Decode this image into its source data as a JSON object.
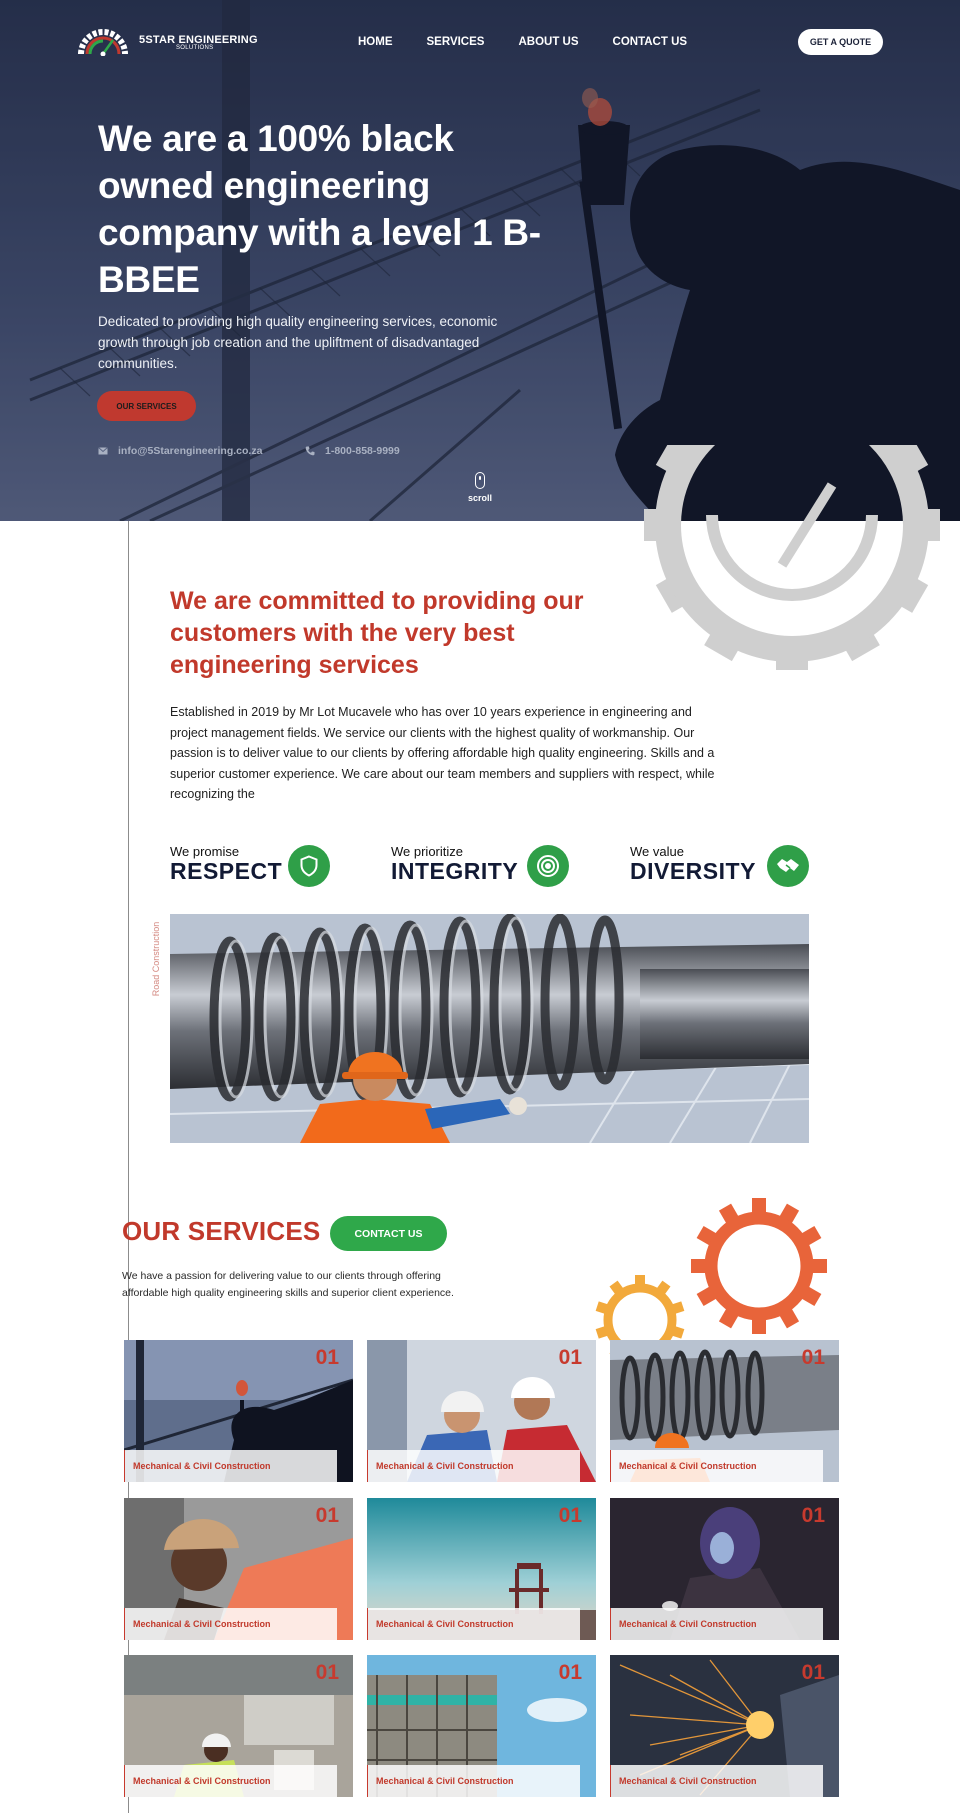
{
  "nav": {
    "logo_title": "5STAR ENGINEERING",
    "logo_subtitle": "SOLUTIONS",
    "links": [
      "HOME",
      "SERVICES",
      "ABOUT US",
      "CONTACT US"
    ],
    "quote_button": "GET A QUOTE"
  },
  "hero": {
    "title": "We are a 100% black owned engineering company with a level 1 B-BBEE",
    "description": "Dedicated to providing high quality engineering services, economic growth through job creation and the upliftment of disadvantaged communities.",
    "button": "OUR SERVICES",
    "email": "info@5Starengineering.co.za",
    "phone": "1-800-858-9999",
    "scroll": "scroll"
  },
  "about": {
    "title": "We are committed to providing our customers with the very best engineering services",
    "text": "Established in 2019 by Mr Lot Mucavele who has over 10 years experience in engineering and project management fields. We service our clients with the highest quality of workmanship. Our passion is to deliver value to our clients by offering affordable high quality engineering. Skills and a superior customer experience. We care about our team members and suppliers with respect, while recognizing the",
    "side_label": "Road Construction",
    "values": [
      {
        "kicker": "We promise",
        "title": "RESPECT",
        "icon": "shield-icon"
      },
      {
        "kicker": "We prioritize",
        "title": "INTEGRITY",
        "icon": "target-icon"
      },
      {
        "kicker": "We value",
        "title": "DIVERSITY",
        "icon": "handshake-icon"
      }
    ]
  },
  "services": {
    "title": "OUR SERVICES",
    "button": "CONTACT US",
    "description": "We have a passion for delivering value to our clients through offering affordable high quality engineering skills and superior client experience.",
    "cards": [
      {
        "number": "01",
        "label": "Mechanical & Civil Construction"
      },
      {
        "number": "01",
        "label": "Mechanical & Civil Construction"
      },
      {
        "number": "01",
        "label": "Mechanical & Civil Construction"
      },
      {
        "number": "01",
        "label": "Mechanical & Civil Construction"
      },
      {
        "number": "01",
        "label": "Mechanical & Civil Construction"
      },
      {
        "number": "01",
        "label": "Mechanical & Civil Construction"
      },
      {
        "number": "01",
        "label": "Mechanical & Civil Construction"
      },
      {
        "number": "01",
        "label": "Mechanical & Civil Construction"
      },
      {
        "number": "01",
        "label": "Mechanical & Civil Construction"
      }
    ]
  },
  "colors": {
    "brand_red": "#c1392b",
    "brand_green": "#2fa84a",
    "hero_navy": "#2a3550",
    "gear_orange": "#e8643a",
    "gear_yellow": "#f2a93b"
  }
}
